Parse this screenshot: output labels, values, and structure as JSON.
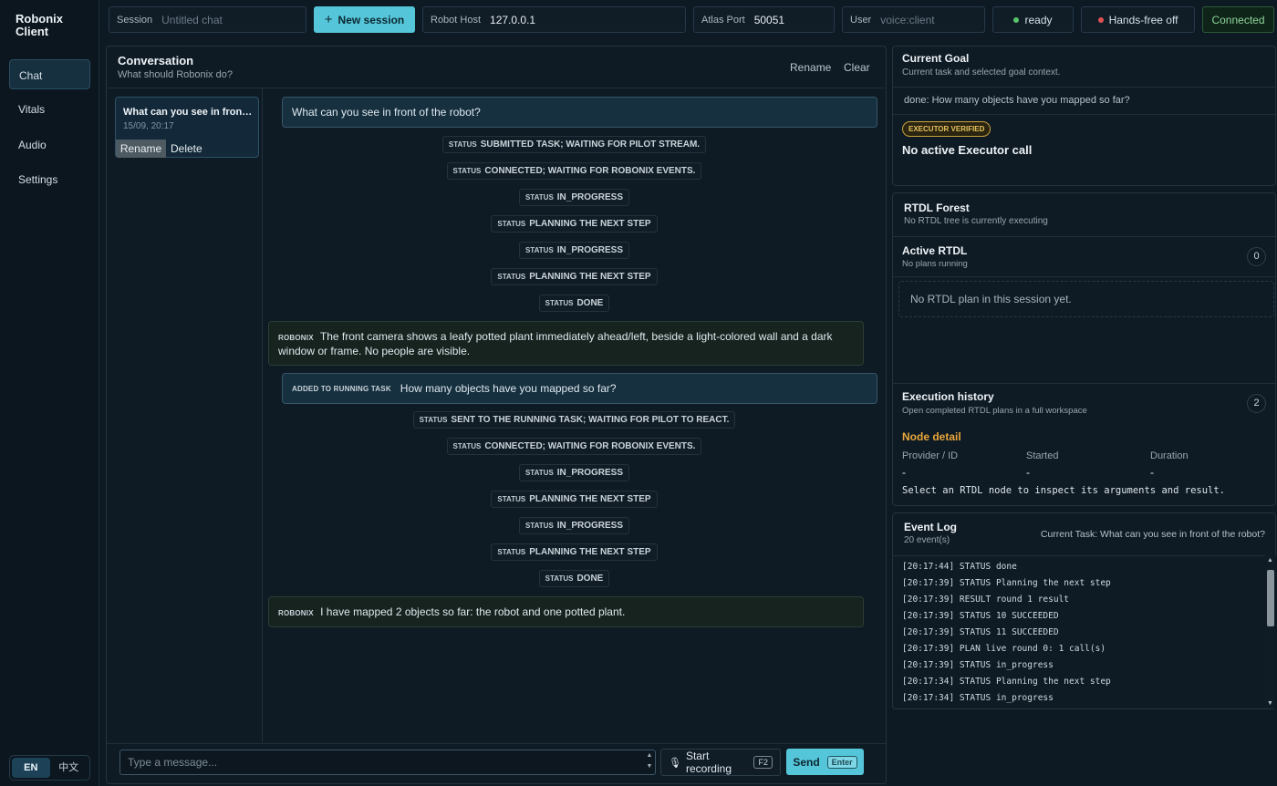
{
  "nav": {
    "brand": "Robonix Client",
    "items": [
      {
        "label": "Chat",
        "active": true
      },
      {
        "label": "Vitals",
        "active": false
      },
      {
        "label": "Audio",
        "active": false
      },
      {
        "label": "Settings",
        "active": false
      }
    ],
    "lang": [
      "EN",
      "中文"
    ],
    "lang_active": "EN"
  },
  "topbar": {
    "session_label": "Session",
    "session_placeholder": "Untitled chat",
    "new_session": "New session",
    "robot_host_label": "Robot Host",
    "robot_host_value": "127.0.0.1",
    "atlas_port_label": "Atlas Port",
    "atlas_port_value": "50051",
    "user_label": "User",
    "user_placeholder": "voice:client",
    "ready": "ready",
    "hands_free": "Hands-free off",
    "connected": "Connected",
    "colors": {
      "accent": "#55c6d9",
      "ready_dot": "#57c46a",
      "handsfree_dot": "#e05252",
      "connected": "#8ed49b"
    }
  },
  "conversation": {
    "title": "Conversation",
    "subtitle": "What should Robonix do?",
    "rename": "Rename",
    "clear": "Clear",
    "session_card": {
      "title": "What can you see in front of the robot?",
      "date": "15/09, 20:17",
      "rename": "Rename",
      "delete": "Delete"
    },
    "messages": [
      {
        "kind": "user",
        "tag": "",
        "text": "What can you see in front of the robot?"
      },
      {
        "kind": "status",
        "tag": "STATUS",
        "text": "SUBMITTED TASK; WAITING FOR PILOT STREAM."
      },
      {
        "kind": "status",
        "tag": "STATUS",
        "text": "CONNECTED; WAITING FOR ROBONIX EVENTS."
      },
      {
        "kind": "status",
        "tag": "STATUS",
        "text": "IN_PROGRESS"
      },
      {
        "kind": "status",
        "tag": "STATUS",
        "text": "PLANNING THE NEXT STEP"
      },
      {
        "kind": "status",
        "tag": "STATUS",
        "text": "IN_PROGRESS"
      },
      {
        "kind": "status",
        "tag": "STATUS",
        "text": "PLANNING THE NEXT STEP"
      },
      {
        "kind": "status",
        "tag": "STATUS",
        "text": "DONE"
      },
      {
        "kind": "bot",
        "tag": "ROBONIX",
        "text": "The front camera shows a leafy potted plant immediately ahead/left, beside a light-colored wall and a dark window or frame. No people are visible."
      },
      {
        "kind": "user",
        "tag": "ADDED TO RUNNING TASK",
        "text": "How many objects have you mapped so far?"
      },
      {
        "kind": "status",
        "tag": "STATUS",
        "text": "SENT TO THE RUNNING TASK; WAITING FOR PILOT TO REACT."
      },
      {
        "kind": "status",
        "tag": "STATUS",
        "text": "CONNECTED; WAITING FOR ROBONIX EVENTS."
      },
      {
        "kind": "status",
        "tag": "STATUS",
        "text": "IN_PROGRESS"
      },
      {
        "kind": "status",
        "tag": "STATUS",
        "text": "PLANNING THE NEXT STEP"
      },
      {
        "kind": "status",
        "tag": "STATUS",
        "text": "IN_PROGRESS"
      },
      {
        "kind": "status",
        "tag": "STATUS",
        "text": "PLANNING THE NEXT STEP"
      },
      {
        "kind": "status",
        "tag": "STATUS",
        "text": "DONE"
      },
      {
        "kind": "bot",
        "tag": "ROBONIX",
        "text": "I have mapped 2 objects so far: the robot and one potted plant."
      }
    ],
    "composer": {
      "placeholder": "Type a message...",
      "record": "Start recording",
      "record_key": "F2",
      "send": "Send",
      "send_key": "Enter"
    }
  },
  "goal": {
    "title": "Current Goal",
    "subtitle": "Current task and selected goal context.",
    "done_line": "done: How many objects have you mapped so far?",
    "badge": "EXECUTOR VERIFIED",
    "executor": "No active Executor call"
  },
  "rtdl": {
    "title": "RTDL Forest",
    "subtitle": "No RTDL tree is currently executing",
    "active_title": "Active RTDL",
    "active_sub": "No plans running",
    "active_count": "0",
    "empty": "No RTDL plan in this session yet.",
    "history_title": "Execution history",
    "history_sub": "Open completed RTDL plans in a full workspace",
    "history_count": "2",
    "node_detail": "Node detail",
    "cols": [
      {
        "label": "Provider / ID",
        "value": "-"
      },
      {
        "label": "Started",
        "value": "-"
      },
      {
        "label": "Duration",
        "value": "-"
      }
    ],
    "hint": "Select an RTDL node to inspect its arguments and result.",
    "colors": {
      "node_detail": "#e9a63a"
    }
  },
  "eventlog": {
    "title": "Event Log",
    "count": "20 event(s)",
    "current_task": "Current Task: What can you see in front of the robot?",
    "lines": [
      "[20:17:44] STATUS done",
      "[20:17:39] STATUS Planning the next step",
      "[20:17:39] RESULT round 1 result",
      "[20:17:39] STATUS 10 SUCCEEDED",
      "[20:17:39] STATUS 11 SUCCEEDED",
      "[20:17:39] PLAN live round 0: 1 call(s)",
      "[20:17:39] STATUS in_progress",
      "[20:17:34] STATUS Planning the next step",
      "[20:17:34] STATUS in_progress"
    ]
  }
}
